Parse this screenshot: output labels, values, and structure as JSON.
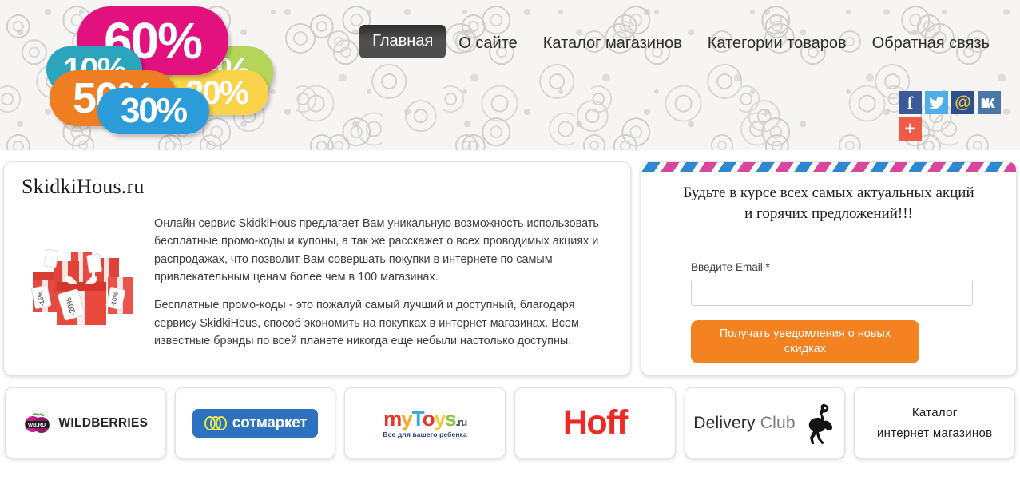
{
  "site": {
    "title": "SkidkiHous.ru"
  },
  "nav": {
    "items": [
      {
        "label": "Главная",
        "active": true
      },
      {
        "label": "О сайте",
        "active": false
      },
      {
        "label": "Каталог магазинов",
        "active": false
      },
      {
        "label": "Категории товаров",
        "active": false
      },
      {
        "label": "Обратная связь",
        "active": false
      }
    ]
  },
  "social": {
    "items": [
      {
        "name": "facebook-icon",
        "glyph": "f",
        "color": "#3a5a98"
      },
      {
        "name": "twitter-icon",
        "glyph": "",
        "color": "#4eaeea"
      },
      {
        "name": "mailru-icon",
        "glyph": "@",
        "color": "#2d4f8e"
      },
      {
        "name": "vk-icon",
        "glyph": "vk",
        "color": "#4a76a8"
      },
      {
        "name": "share-plus-icon",
        "glyph": "+",
        "color": "#ef5b46"
      }
    ]
  },
  "banner": {
    "badges": [
      {
        "label": "60%",
        "color": "#e2117f"
      },
      {
        "label": "40%",
        "color": "#b4d55a"
      },
      {
        "label": "20%",
        "color": "#fbd34b"
      },
      {
        "label": "10%",
        "color": "#2aa5bd"
      },
      {
        "label": "50%",
        "color": "#ef7d22"
      },
      {
        "label": "30%",
        "color": "#2b9bd9"
      }
    ]
  },
  "about": {
    "image_alt": "red-gift-boxes-with-discount-tags",
    "paragraph1": "Онлайн сервис SkidkiHous предлагает Вам уникальную возможность использовать бесплатные промо-коды и купоны, а так же расскажет о всех проводимых акциях и распродажах, что позволит Вам совершать покупки в интернете по самым привлекательным ценам более чем в 100 магазинах.",
    "paragraph2": "Бесплатные промо-коды - это пожалуй самый лучший и доступный, благодаря сервису SkidkiHous, способ экономить на покупках в интернет магазинах. Всем известные брэнды по всей планете никогда еще небыли настолько доступны."
  },
  "subscribe": {
    "heading_line1": "Будьте в курсе всех самых актуальных акций",
    "heading_line2": "и горячих предложений!!!",
    "email_label": "Введите Email",
    "required_mark": "*",
    "email_value": "",
    "email_placeholder": "",
    "button_label": "Получать уведомления о новых скидках",
    "button_color": "#f58220",
    "stripe_colors": [
      "#d9469e",
      "#2f86d1"
    ]
  },
  "partners": [
    {
      "name": "wildberries",
      "text": "WILDBERRIES",
      "mark": "WB.RU"
    },
    {
      "name": "sotmarket",
      "text": "сотмаркет"
    },
    {
      "name": "mytoys",
      "text": "myToys",
      "suffix": ".ru",
      "tagline": "Все для вашего ребенка"
    },
    {
      "name": "hoff",
      "text": "Hoff"
    },
    {
      "name": "delivery-club",
      "text": "Delivery",
      "text2": "Club"
    },
    {
      "name": "catalog",
      "line1": "Каталог",
      "line2": "интернет магазинов"
    }
  ]
}
